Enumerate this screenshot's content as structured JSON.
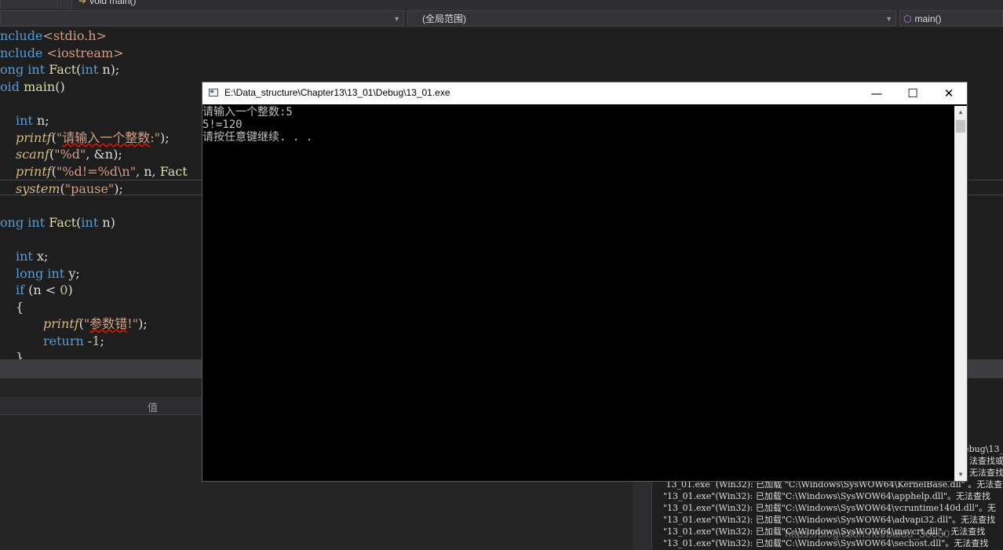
{
  "toolbar": {
    "function_label": "void main()"
  },
  "navbar": {
    "scope": "(全局范围)",
    "member": "main()"
  },
  "code": {
    "l1": {
      "a": "nclude",
      "b": "<stdio.h>"
    },
    "l2": {
      "a": "nclude ",
      "b": "<iostream>"
    },
    "l3": {
      "kw": "ong int ",
      "fn": "Fact",
      "p1": "(",
      "kw2": "int",
      "p2": " n);"
    },
    "l4": {
      "kw": "oid ",
      "fn": "main",
      "p": "()"
    },
    "l5": {
      "kw": "int",
      "p": " n;"
    },
    "l6": {
      "fn": "printf",
      "p1": "(",
      "str1": "\"",
      "sq": "请输入一个整数",
      "str2": ":\"",
      "p2": ");"
    },
    "l7": {
      "fn": "scanf",
      "p1": "(",
      "str": "\"%d\"",
      "p2": ", &n);"
    },
    "l8": {
      "fn": "printf",
      "p1": "(",
      "str": "\"%d!=%d\\n\"",
      "p2": ", n, ",
      "fn2": "Fact"
    },
    "l9": {
      "fn": "system",
      "p1": "(",
      "str": "\"pause\"",
      "p2": ");"
    },
    "l10": {
      "kw": "ong int ",
      "fn": "Fact",
      "p1": "(",
      "kw2": "int",
      "p2": " n)"
    },
    "l11": {
      "kw": "int",
      "p": " x;"
    },
    "l12": {
      "kw": "long int",
      "p": " y;"
    },
    "l13": {
      "kw": "if",
      "p1": " (n < ",
      "num": "0",
      "p2": ")"
    },
    "l14": {
      "p": "{"
    },
    "l15": {
      "fn": "printf",
      "p1": "(",
      "str1": "\"",
      "sq": "参数错",
      "str2": "!\"",
      "p2": ");"
    },
    "l16": {
      "kw": "return",
      "p1": " -",
      "num": "1",
      "p2": ";"
    },
    "l17": {
      "p": "}"
    }
  },
  "watch": {
    "value_header": "值"
  },
  "output": {
    "lines": [
      "ebug\\13_",
      "法查找或",
      "。无法查找",
      " 13_01.exe  (Win32): 已加载 \"C:\\Windows\\SysWOW64\\KernelBase.dll\" 。无法查",
      "\"13_01.exe\"(Win32): 已加载\"C:\\Windows\\SysWOW64\\apphelp.dll\"。无法查找",
      "\"13_01.exe\"(Win32): 已加载\"C:\\Windows\\SysWOW64\\vcruntime140d.dll\"。无",
      "\"13_01.exe\"(Win32): 已加载\"C:\\Windows\\SysWOW64\\advapi32.dll\"。无法查找",
      "\"13_01.exe\"(Win32): 已加载\"C:\\Windows\\SysWOW64\\msvcrt.dll\"。无法查找",
      "\"13_01.exe\"(Win32): 已加载\"C:\\Windows\\SysWOW64\\sechost.dll\"。无法查找"
    ]
  },
  "watermark": "https://blog.csdn.net/baidu_36660",
  "console": {
    "title": "E:\\Data_structure\\Chapter13\\13_01\\Debug\\13_01.exe",
    "minimize": "—",
    "maximize": "☐",
    "close": "✕",
    "lines": [
      "请输入一个整数:5",
      "5!=120",
      "请按任意键继续. . ."
    ]
  },
  "icons": {
    "arrow": "function-arrow-icon",
    "member": "cube-icon",
    "app": "console-app-icon"
  }
}
